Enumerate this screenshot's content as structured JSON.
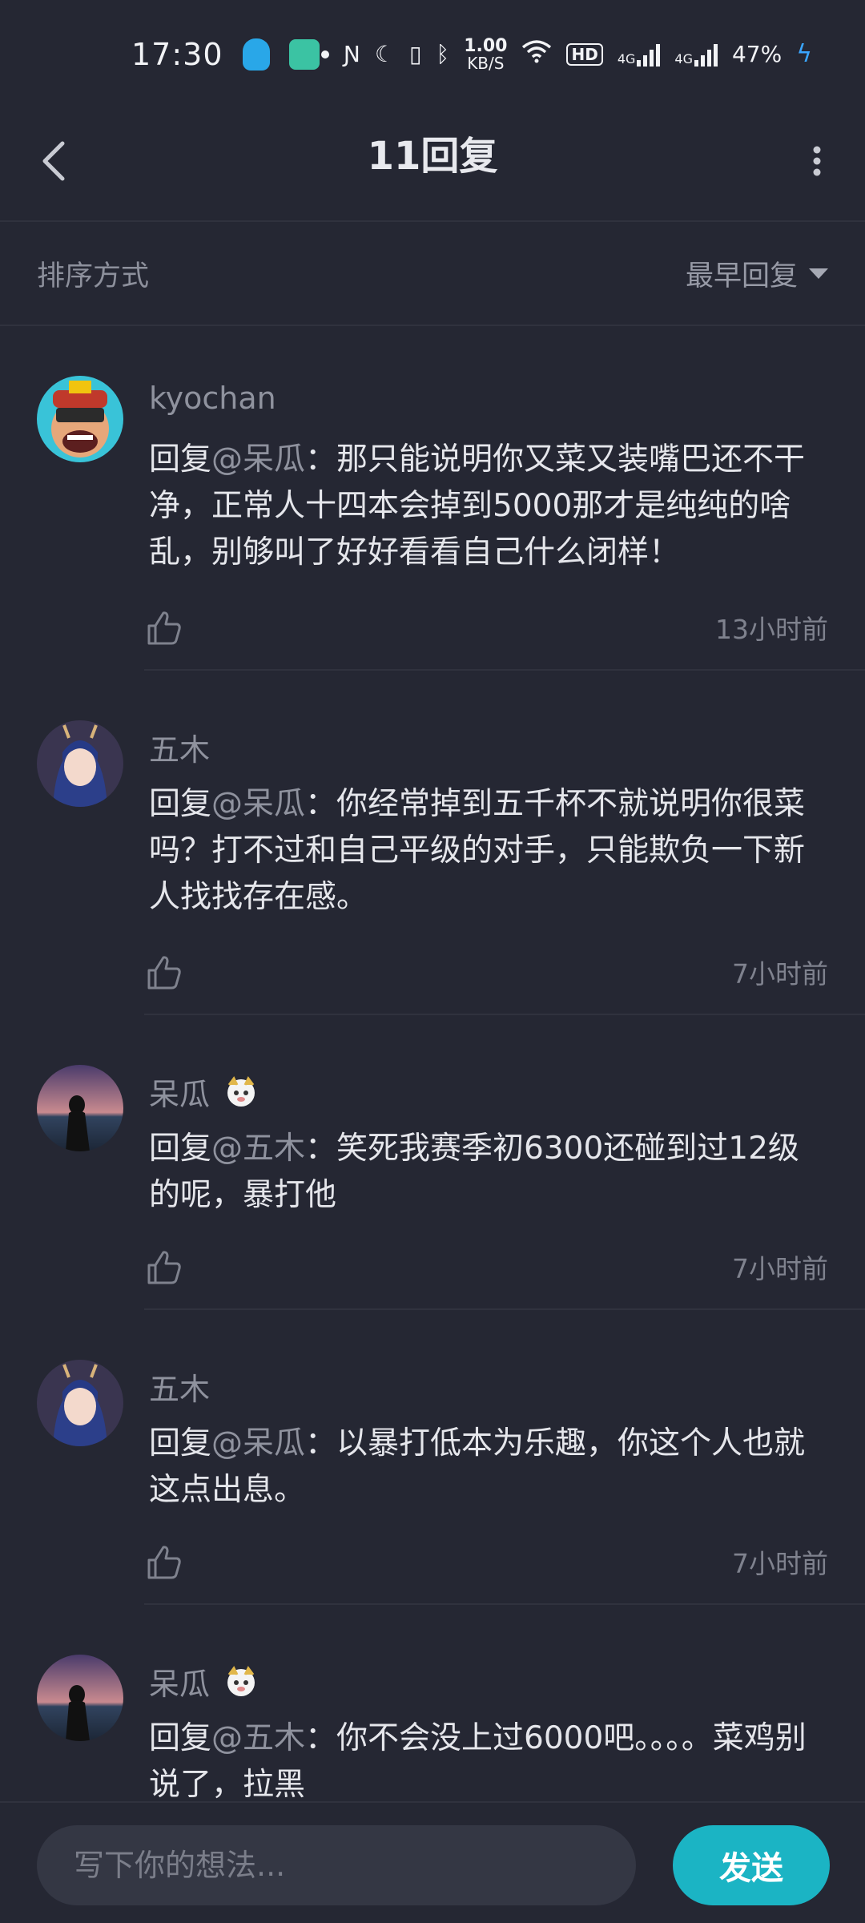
{
  "status_bar": {
    "time": "17:30",
    "net_speed_value": "1.00",
    "net_speed_unit": "KB/S",
    "hd_label": "HD",
    "signal1_label": "4G",
    "signal2_label": "4G",
    "battery": "47%"
  },
  "header": {
    "title": "11回复",
    "back_icon": "chevron-left-icon",
    "more_icon": "more-vertical-icon"
  },
  "sort": {
    "label": "排序方式",
    "selected": "最早回复"
  },
  "replies": [
    {
      "username": "kyochan",
      "reply_prefix": "回复",
      "mention": "@呆瓜",
      "separator": "：",
      "text": "那只能说明你又菜又装嘴巴还不干净，正常人十四本会掉到5000那才是纯纯的啥乱，别够叫了好好看看自己什么闭样！",
      "time": "13小时前"
    },
    {
      "username": "五木",
      "reply_prefix": "回复",
      "mention": "@呆瓜",
      "separator": "：",
      "text": "你经常掉到五千杯不就说明你很菜吗？打不过和自己平级的对手，只能欺负一下新人找找存在感。",
      "time": "7小时前"
    },
    {
      "username": "呆瓜",
      "reply_prefix": "回复",
      "mention": "@五木",
      "separator": "：",
      "text": "笑死我赛季初6300还碰到过12级的呢，暴打他",
      "time": "7小时前"
    },
    {
      "username": "五木",
      "reply_prefix": "回复",
      "mention": "@呆瓜",
      "separator": "：",
      "text": "以暴打低本为乐趣，你这个人也就这点出息。",
      "time": "7小时前"
    },
    {
      "username": "呆瓜",
      "reply_prefix": "回复",
      "mention": "@五木",
      "separator": "：",
      "text": "你不会没上过6000吧。。。。菜鸡别说了，拉黑",
      "time": ""
    }
  ],
  "composer": {
    "placeholder": "写下你的想法...",
    "send_label": "发送"
  }
}
